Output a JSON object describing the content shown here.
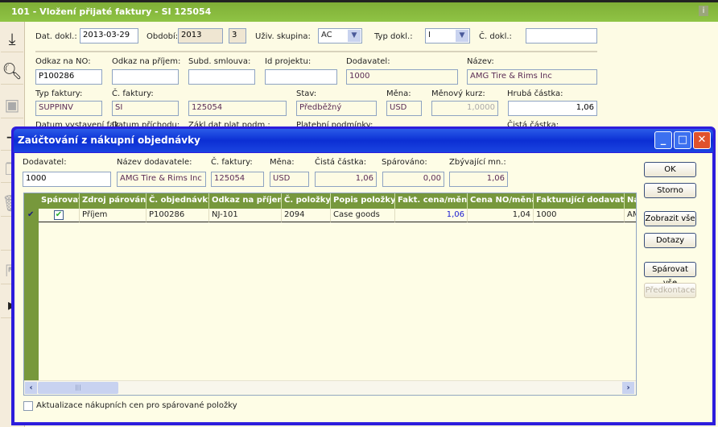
{
  "window": {
    "title": "101 - Vložení přijaté faktury - SI 125054",
    "info_icon": "i"
  },
  "toolbar": [
    "download-icon",
    "search-icon",
    "save-icon",
    "add-icon",
    "copy-icon",
    "delete-icon",
    "list-icon",
    "export-icon",
    "post-icon"
  ],
  "form": {
    "dat_dokl": {
      "label": "Dat. dokl.:",
      "value": "2013-03-29"
    },
    "obdobi": {
      "label": "Období:",
      "year": "2013",
      "period": "3"
    },
    "uziv_skupina": {
      "label": "Uživ. skupina:",
      "value": "AC"
    },
    "typ_dokl": {
      "label": "Typ dokl.:",
      "value": "I"
    },
    "c_dokl": {
      "label": "Č. dokl.:",
      "value": ""
    },
    "odkaz_no": {
      "label": "Odkaz na NO:",
      "value": "P100286"
    },
    "odkaz_prijem": {
      "label": "Odkaz na příjem:",
      "value": ""
    },
    "subd_smlouva": {
      "label": "Subd. smlouva:",
      "value": ""
    },
    "id_projektu": {
      "label": "Id projektu:",
      "value": ""
    },
    "dodavatel": {
      "label": "Dodavatel:",
      "value": "1000"
    },
    "nazev": {
      "label": "Název:",
      "value": "AMG Tire & Rims Inc"
    },
    "typ_faktury": {
      "label": "Typ faktury:",
      "value": "SUPPINV"
    },
    "c_faktury": {
      "label": "Č. faktury:",
      "prefix": "SI",
      "value": "125054"
    },
    "stav": {
      "label": "Stav:",
      "value": "Předběžný"
    },
    "mena": {
      "label": "Měna:",
      "value": "USD"
    },
    "menovy_kurz": {
      "label": "Měnový kurz:",
      "value": "1,0000"
    },
    "hruba_castka": {
      "label": "Hrubá částka:",
      "value": "1,06"
    },
    "datum_vystaveni": {
      "label": "Datum vystavení fak"
    },
    "datum_prichodu": {
      "label": "Datum příchodu:"
    },
    "zakl_dat": {
      "label": "Zákl.dat.plat.podm.:"
    },
    "platebni_podminky": {
      "label": "Platební podmínky:"
    },
    "cista_castka": {
      "label": "Čistá částka:"
    }
  },
  "dialog": {
    "title": "Zaúčtování z nákupní objednávky",
    "fields": {
      "dodavatel": {
        "label": "Dodavatel:",
        "value": "1000"
      },
      "nazev": {
        "label": "Název dodavatele:",
        "value": "AMG Tire & Rims Inc"
      },
      "c_faktury": {
        "label": "Č. faktury:",
        "value": "125054"
      },
      "mena": {
        "label": "Měna:",
        "value": "USD"
      },
      "cista_castka": {
        "label": "Čistá částka:",
        "value": "1,06"
      },
      "sparovano": {
        "label": "Spárováno:",
        "value": "0,00"
      },
      "zbyvajici": {
        "label": "Zbývající mn.:",
        "value": "1,06"
      }
    },
    "columns": [
      "Spárovat",
      "Zdroj párování",
      "Č. objednávky",
      "Odkaz na příjem",
      "Č. položky",
      "Popis položky",
      "Fakt. cena/měna",
      "Cena NO/měna",
      "Fakturující dodavatel",
      "Ná"
    ],
    "rows": [
      {
        "sparovat": true,
        "zdroj": "Příjem",
        "objednavka": "P100286",
        "odkaz": "NJ-101",
        "polozka": "2094",
        "popis": "Case goods",
        "fakt_cena": "1,06",
        "cena_no": "1,04",
        "dodavatel": "1000",
        "nazev": "AM"
      }
    ],
    "buttons": {
      "ok": "OK",
      "storno": "Storno",
      "zobrazit": "Zobrazit vše",
      "dotazy": "Dotazy",
      "sparovat": "Spárovat vše",
      "predkontace": "Předkontace"
    },
    "update_prices": {
      "label": "Aktualizace nákupních cen pro spárované položky",
      "checked": false
    }
  }
}
